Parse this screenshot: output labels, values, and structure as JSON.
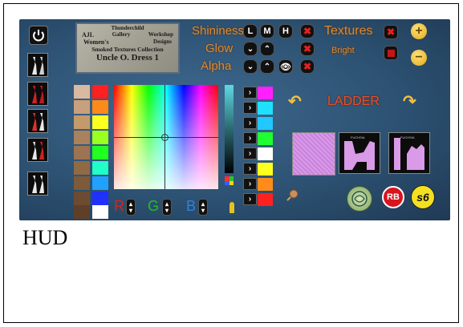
{
  "title_card": {
    "line1": "Thunderchild",
    "line2": "Gallery",
    "line3_left": "AJL",
    "line3_right": "Workshop",
    "line4_left": "Women's",
    "line4_right": "Designs",
    "line5": "Smoked Textures Collection",
    "line6": "Uncle O. Dress 1"
  },
  "labels": {
    "shininess": "Shininess",
    "glow": "Glow",
    "alpha": "Alpha",
    "textures": "Textures",
    "bright": "Bright",
    "ladder": "LADDER",
    "r": "R",
    "g": "G",
    "b": "B",
    "hud_caption": "HUD"
  },
  "shine_buttons": [
    "L",
    "M",
    "H"
  ],
  "logo_rb": "RB",
  "logo_s6": "s6",
  "thumb_captions": [
    "FUCHSIA",
    "FUCHSIA"
  ],
  "colors": {
    "accent_orange": "#d98a3a",
    "accent_red": "#c41616",
    "hud_blue": "#2d5273"
  },
  "left_swatches": [
    "#d9b9a0",
    "#c8a07d",
    "#c59a6a",
    "#a8825d",
    "#9c7452",
    "#8f6a45",
    "#7d5a3a",
    "#6d4b32",
    "#5f3f28"
  ],
  "right_swatches": [
    "#ff2020",
    "#ff8a1a",
    "#ffff20",
    "#9bff20",
    "#20ff20",
    "#20ffc8",
    "#20a0ff",
    "#2030ff",
    "#ffffff"
  ],
  "color_column": [
    "#ff20ff",
    "#20e0ff",
    "#20c8ff",
    "#20ff30",
    "#ffffff",
    "#ffff20",
    "#ff8c1a",
    "#ff2020"
  ]
}
